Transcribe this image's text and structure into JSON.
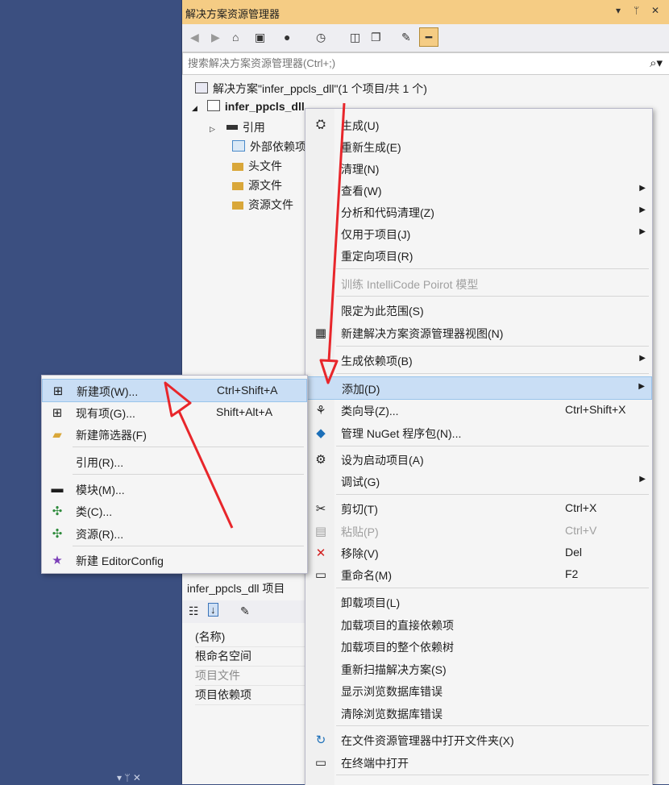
{
  "solution_explorer": {
    "title": "解决方案资源管理器",
    "title_controls": [
      "▾",
      "ᛘ",
      "✕"
    ],
    "search_placeholder": "搜索解决方案资源管理器(Ctrl+;)",
    "tree": {
      "solution": "解决方案\"infer_ppcls_dll\"(1 个项目/共 1 个)",
      "project": "infer_ppcls_dll",
      "items": [
        "引用",
        "外部依赖项",
        "头文件",
        "源文件",
        "资源文件"
      ]
    }
  },
  "properties": {
    "header": "infer_ppcls_dll 项目",
    "rows": [
      "(名称)",
      "根命名空间",
      "项目文件",
      "项目依赖项"
    ]
  },
  "context_menu": {
    "items": [
      {
        "label": "生成(U)",
        "icon": "build-icon"
      },
      {
        "label": "重新生成(E)"
      },
      {
        "label": "清理(N)"
      },
      {
        "label": "查看(W)",
        "submenu": true
      },
      {
        "label": "分析和代码清理(Z)",
        "submenu": true
      },
      {
        "label": "仅用于项目(J)",
        "submenu": true
      },
      {
        "label": "重定向项目(R)"
      },
      {
        "label": "训练 IntelliCode Poirot 模型",
        "disabled": true
      },
      {
        "label": "限定为此范围(S)"
      },
      {
        "label": "新建解决方案资源管理器视图(N)",
        "icon": "new-view-icon"
      },
      {
        "label": "生成依赖项(B)",
        "submenu": true
      },
      {
        "label": "添加(D)",
        "submenu": true,
        "highlighted": true
      },
      {
        "label": "类向导(Z)...",
        "shortcut": "Ctrl+Shift+X",
        "icon": "class-wizard-icon"
      },
      {
        "label": "管理 NuGet 程序包(N)...",
        "icon": "nuget-icon"
      },
      {
        "label": "设为启动项目(A)",
        "icon": "gear-icon"
      },
      {
        "label": "调试(G)",
        "submenu": true
      },
      {
        "label": "剪切(T)",
        "shortcut": "Ctrl+X",
        "icon": "cut-icon"
      },
      {
        "label": "粘贴(P)",
        "shortcut": "Ctrl+V",
        "disabled": true,
        "icon": "paste-icon"
      },
      {
        "label": "移除(V)",
        "shortcut": "Del",
        "icon": "remove-icon"
      },
      {
        "label": "重命名(M)",
        "shortcut": "F2",
        "icon": "rename-icon"
      },
      {
        "label": "卸载项目(L)"
      },
      {
        "label": "加载项目的直接依赖项"
      },
      {
        "label": "加载项目的整个依赖树"
      },
      {
        "label": "重新扫描解决方案(S)"
      },
      {
        "label": "显示浏览数据库错误"
      },
      {
        "label": "清除浏览数据库错误"
      },
      {
        "label": "在文件资源管理器中打开文件夹(X)",
        "icon": "open-folder-icon"
      },
      {
        "label": "在终端中打开",
        "icon": "terminal-icon"
      }
    ]
  },
  "add_submenu": {
    "items": [
      {
        "label": "新建项(W)...",
        "shortcut": "Ctrl+Shift+A",
        "highlighted": true
      },
      {
        "label": "现有项(G)...",
        "shortcut": "Shift+Alt+A"
      },
      {
        "label": "新建筛选器(F)"
      },
      {
        "label": "引用(R)..."
      },
      {
        "label": "模块(M)..."
      },
      {
        "label": "类(C)..."
      },
      {
        "label": "资源(R)..."
      },
      {
        "label": "新建 EditorConfig"
      }
    ]
  },
  "colors": {
    "title_bar": "#f5cc84",
    "highlight": "#c9def5",
    "arrow": "#e8262b",
    "background": "#3b4f80"
  }
}
